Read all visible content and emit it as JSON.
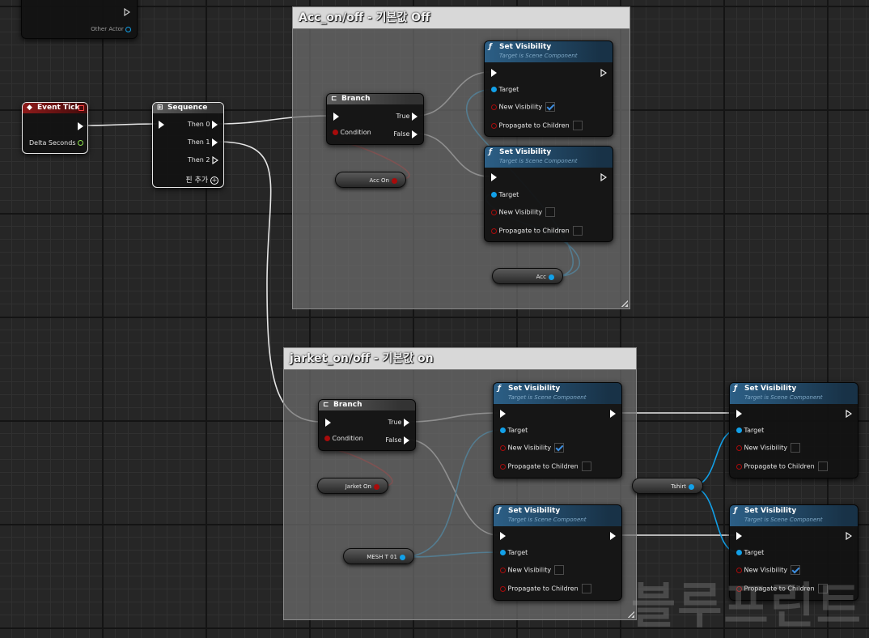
{
  "colors": {
    "exec_wire": "#e6e6e6",
    "bool_wire": "#a80b0b",
    "object_wire": "#12a0e8",
    "function_header": "#2c5f86",
    "event_header": "#8e1b1b"
  },
  "top_node": {
    "pin_label": "Other Actor",
    "icon": "exec-out-outline-icon"
  },
  "event_tick": {
    "title": "Event Tick",
    "delta_label": "Delta Seconds",
    "icon": "event-diamond-icon"
  },
  "sequence": {
    "title": "Sequence",
    "outputs": [
      "Then 0",
      "Then 1",
      "Then 2"
    ],
    "add_pin_label": "핀 추가",
    "icon": "sequence-icon"
  },
  "comments": [
    {
      "title": "Acc_on/off - 기본값 Off"
    },
    {
      "title": "jarket_on/off - 기본값 on"
    }
  ],
  "branch_top": {
    "title": "Branch",
    "true_label": "True",
    "false_label": "False",
    "condition_label": "Condition",
    "icon": "branch-icon"
  },
  "branch_bottom": {
    "title": "Branch",
    "true_label": "True",
    "false_label": "False",
    "condition_label": "Condition",
    "icon": "branch-icon"
  },
  "set_visibility": {
    "title": "Set Visibility",
    "subtitle": "Target is Scene Component",
    "target_label": "Target",
    "new_visibility_label": "New Visibility",
    "propagate_label": "Propagate to Children",
    "icon": "function-f-icon"
  },
  "sv_states": {
    "acc_true": true,
    "acc_false": false,
    "jarket_true": true,
    "jarket_false": false,
    "tshirt_a": false,
    "tshirt_b": true
  },
  "variables": {
    "acc_on": "Acc On",
    "acc": "Acc",
    "jarket_on": "Jarket On",
    "mesh": "MESH T 01",
    "tshirt": "Tshirt"
  },
  "watermark": "블루프린트"
}
